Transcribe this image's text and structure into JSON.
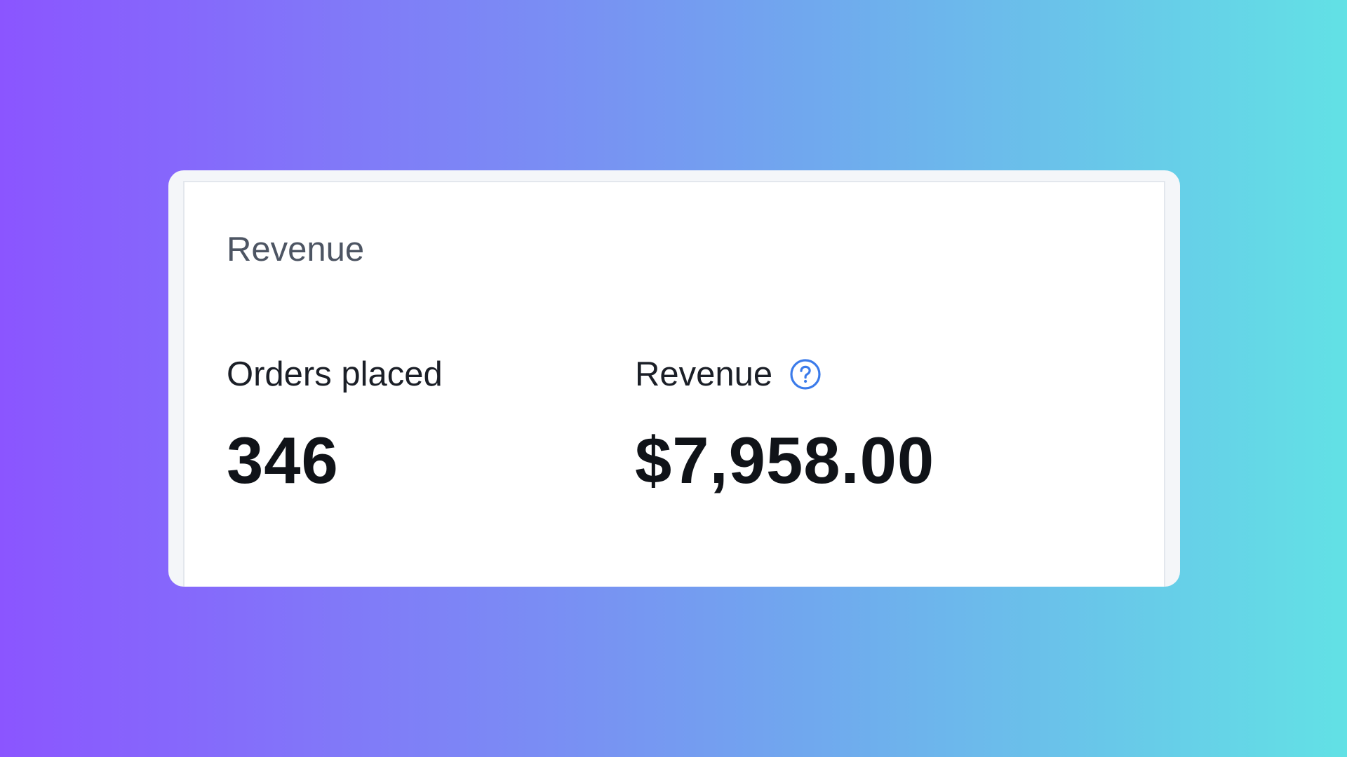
{
  "card": {
    "title": "Revenue"
  },
  "metrics": [
    {
      "label": "Orders placed",
      "value": "346"
    },
    {
      "label": "Revenue",
      "value": "$7,958.00",
      "help_icon": "question-circle-icon"
    }
  ],
  "colors": {
    "gradient_start": "#8b55ff",
    "gradient_end": "#62e1e5",
    "help_icon": "#3b7bea",
    "title_text": "#4d5563",
    "value_text": "#101318"
  }
}
